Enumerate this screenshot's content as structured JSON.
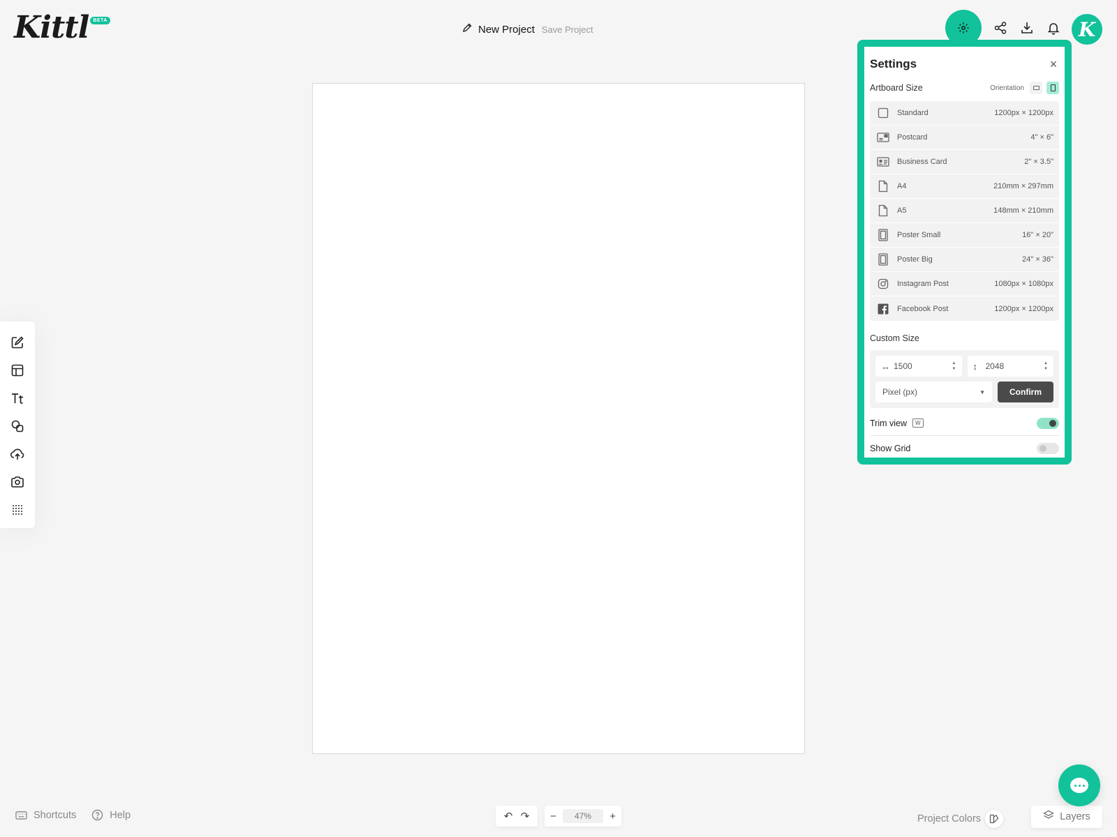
{
  "brand": {
    "logo": "Kittl",
    "badge": "BETA",
    "accent": "#11c29b"
  },
  "header": {
    "project_name": "New Project",
    "save_label": "Save Project",
    "avatar_letter": "K"
  },
  "settings": {
    "title": "Settings",
    "artboard_size_label": "Artboard Size",
    "orientation_label": "Orientation",
    "sizes": [
      {
        "name": "Standard",
        "dim": "1200px × 1200px",
        "icon": "square-icon"
      },
      {
        "name": "Postcard",
        "dim": "4\" × 6\"",
        "icon": "postcard-icon"
      },
      {
        "name": "Business Card",
        "dim": "2\" × 3.5\"",
        "icon": "business-card-icon"
      },
      {
        "name": "A4",
        "dim": "210mm × 297mm",
        "icon": "document-icon"
      },
      {
        "name": "A5",
        "dim": "148mm × 210mm",
        "icon": "document-icon"
      },
      {
        "name": "Poster Small",
        "dim": "16\" × 20\"",
        "icon": "poster-icon"
      },
      {
        "name": "Poster Big",
        "dim": "24\" × 36\"",
        "icon": "poster-icon"
      },
      {
        "name": "Instagram Post",
        "dim": "1080px × 1080px",
        "icon": "instagram-icon"
      },
      {
        "name": "Facebook Post",
        "dim": "1200px × 1200px",
        "icon": "facebook-icon"
      }
    ],
    "custom_size_label": "Custom Size",
    "width_value": "1500",
    "height_value": "2048",
    "unit_value": "Pixel (px)",
    "confirm_label": "Confirm",
    "trim_view_label": "Trim view",
    "trim_view_key": "W",
    "trim_view_on": true,
    "show_grid_label": "Show Grid",
    "show_grid_on": false
  },
  "bottom": {
    "shortcuts_label": "Shortcuts",
    "help_label": "Help",
    "zoom_value": "47%",
    "project_colors_label": "Project Colors",
    "layers_label": "Layers"
  }
}
